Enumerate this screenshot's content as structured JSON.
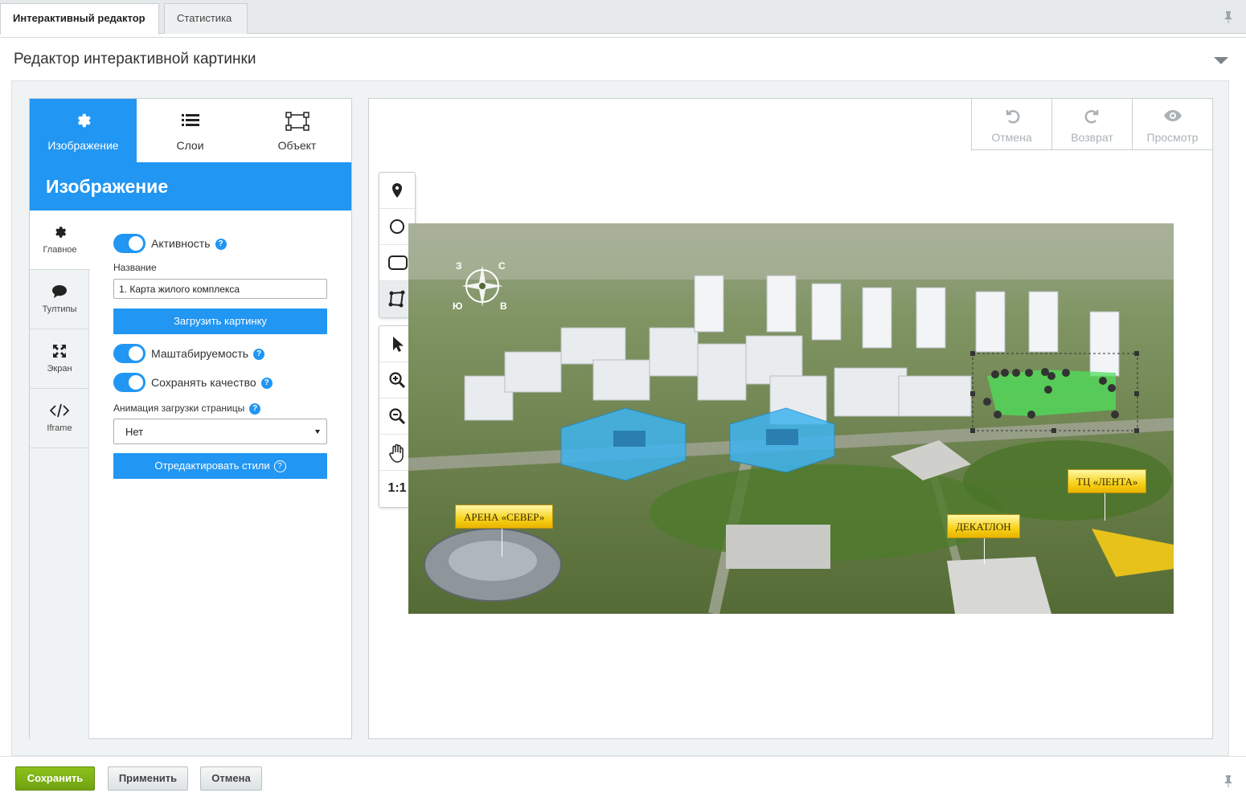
{
  "tabs": [
    {
      "label": "Интерактивный редактор",
      "active": true
    },
    {
      "label": "Статистика",
      "active": false
    }
  ],
  "panel": {
    "title": "Редактор интерактивной картинки"
  },
  "left_tabs": [
    {
      "label": "Изображение",
      "icon": "gear-icon",
      "active": true
    },
    {
      "label": "Слои",
      "icon": "layers-list-icon",
      "active": false
    },
    {
      "label": "Объект",
      "icon": "object-bounds-icon",
      "active": false
    }
  ],
  "section_header": "Изображение",
  "vertical_tabs": [
    {
      "label": "Главное",
      "icon": "gear-icon",
      "active": true
    },
    {
      "label": "Тултипы",
      "icon": "speech-bubble-icon",
      "active": false
    },
    {
      "label": "Экран",
      "icon": "fullscreen-arrows-icon",
      "active": false
    },
    {
      "label": "Iframe",
      "icon": "code-brackets-icon",
      "active": false
    }
  ],
  "form": {
    "active_label": "Активность",
    "name_label": "Название",
    "name_value": "1. Карта жилого комплекса",
    "upload_button": "Загрузить картинку",
    "scalable_label": "Маштабируемость",
    "quality_label": "Сохранять качество",
    "animation_label": "Анимация загрузки страницы",
    "animation_value": "Нет",
    "edit_styles_button": "Отредактировать стили",
    "help_glyph": "?"
  },
  "history": [
    {
      "label": "Отмена",
      "icon": "undo-icon"
    },
    {
      "label": "Возврат",
      "icon": "redo-icon"
    },
    {
      "label": "Просмотр",
      "icon": "eye-icon"
    }
  ],
  "tools": [
    {
      "name": "marker-tool",
      "icon": "map-pin-icon"
    },
    {
      "name": "circle-tool",
      "icon": "circle-icon"
    },
    {
      "name": "rect-tool",
      "icon": "rounded-rect-icon"
    },
    {
      "name": "polygon-tool",
      "icon": "polygon-icon",
      "active": true
    },
    {
      "name": "select-tool",
      "icon": "cursor-arrow-icon"
    },
    {
      "name": "zoom-in-tool",
      "icon": "zoom-in-icon"
    },
    {
      "name": "zoom-out-tool",
      "icon": "zoom-out-icon"
    },
    {
      "name": "pan-tool",
      "icon": "hand-icon"
    },
    {
      "name": "actual-size-tool",
      "label": "1:1"
    }
  ],
  "map": {
    "labels": [
      "АРЕНА «СЕВЕР»",
      "ДЕКАТЛОН",
      "ТЦ «ЛЕНТА»"
    ],
    "compass": {
      "n": "С",
      "w": "З",
      "s": "Ю",
      "e": "В"
    },
    "highlight_colors": {
      "blue": "#3fb4f0",
      "green": "#4ee05a"
    }
  },
  "footer": {
    "save": "Сохранить",
    "apply": "Применить",
    "cancel": "Отмена"
  },
  "colors": {
    "accent": "#2196f3",
    "save_green": "#7cb518"
  }
}
